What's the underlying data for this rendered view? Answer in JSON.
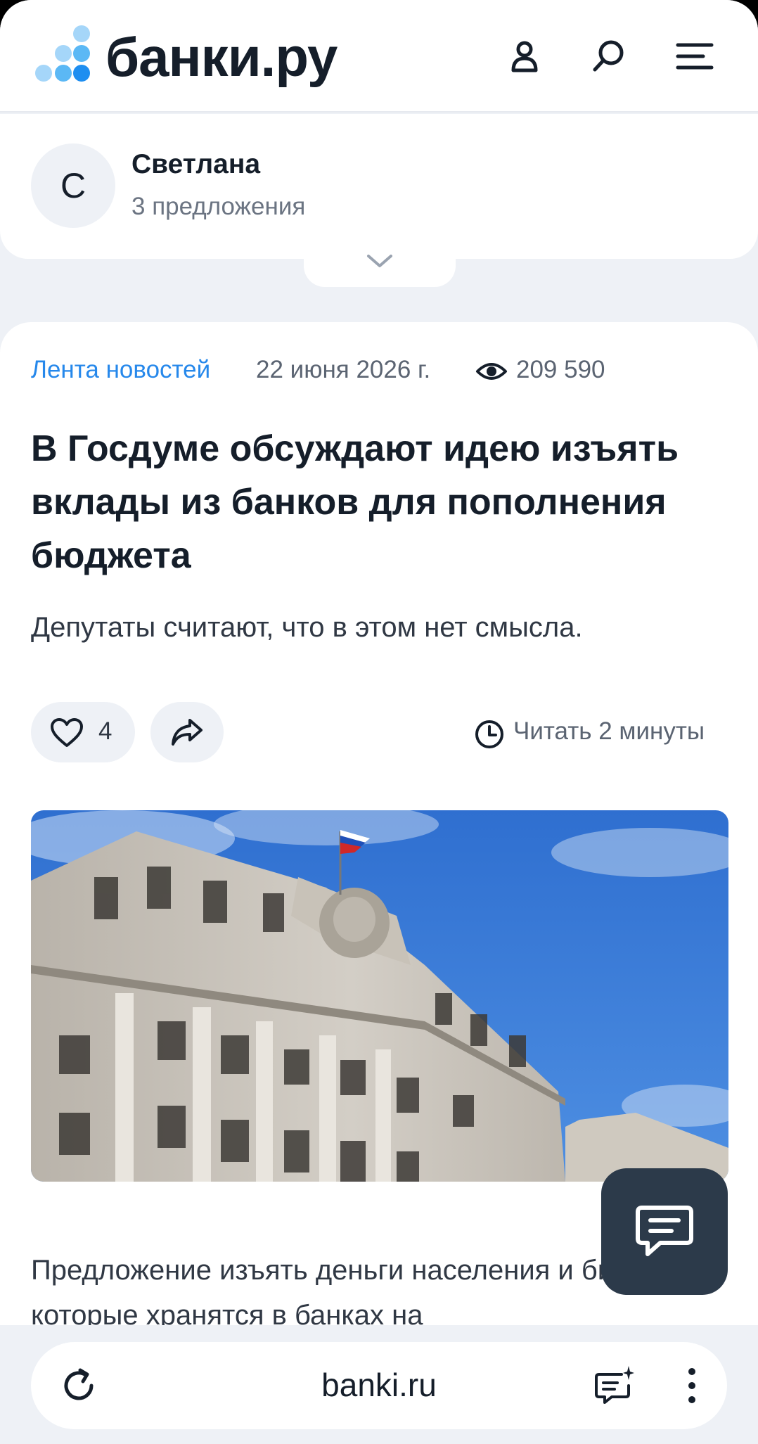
{
  "header": {
    "brand": "банки.ру",
    "icons": [
      "profile-icon",
      "search-icon",
      "menu-icon"
    ],
    "colors": {
      "brand_text": "#151e2a",
      "logo_light": "#a5d6f9",
      "logo_mid": "#5bb8f5",
      "logo_dark": "#1e8ef0"
    }
  },
  "profile": {
    "initial": "С",
    "name": "Светлана",
    "offers": "3 предложения"
  },
  "article": {
    "rubric": "Лента новостей",
    "date": "22 июня 2026 г.",
    "views": "209 590",
    "title": "В Госдуме обсуждают идею изъять вклады из банков для пополнения бюджета",
    "lead": "Депутаты считают, что в этом нет смысла.",
    "likes": "4",
    "read_time": "Читать 2 минуты",
    "body_start": "Предложение изъять деньги населения и бизнеса, которые хранятся в банках на",
    "colors": {
      "rubric": "#2688eb",
      "title": "#151e2a"
    }
  },
  "browser": {
    "url": "banki.ru",
    "icons": [
      "reload-icon",
      "notes-icon",
      "more-vertical-icon"
    ]
  }
}
